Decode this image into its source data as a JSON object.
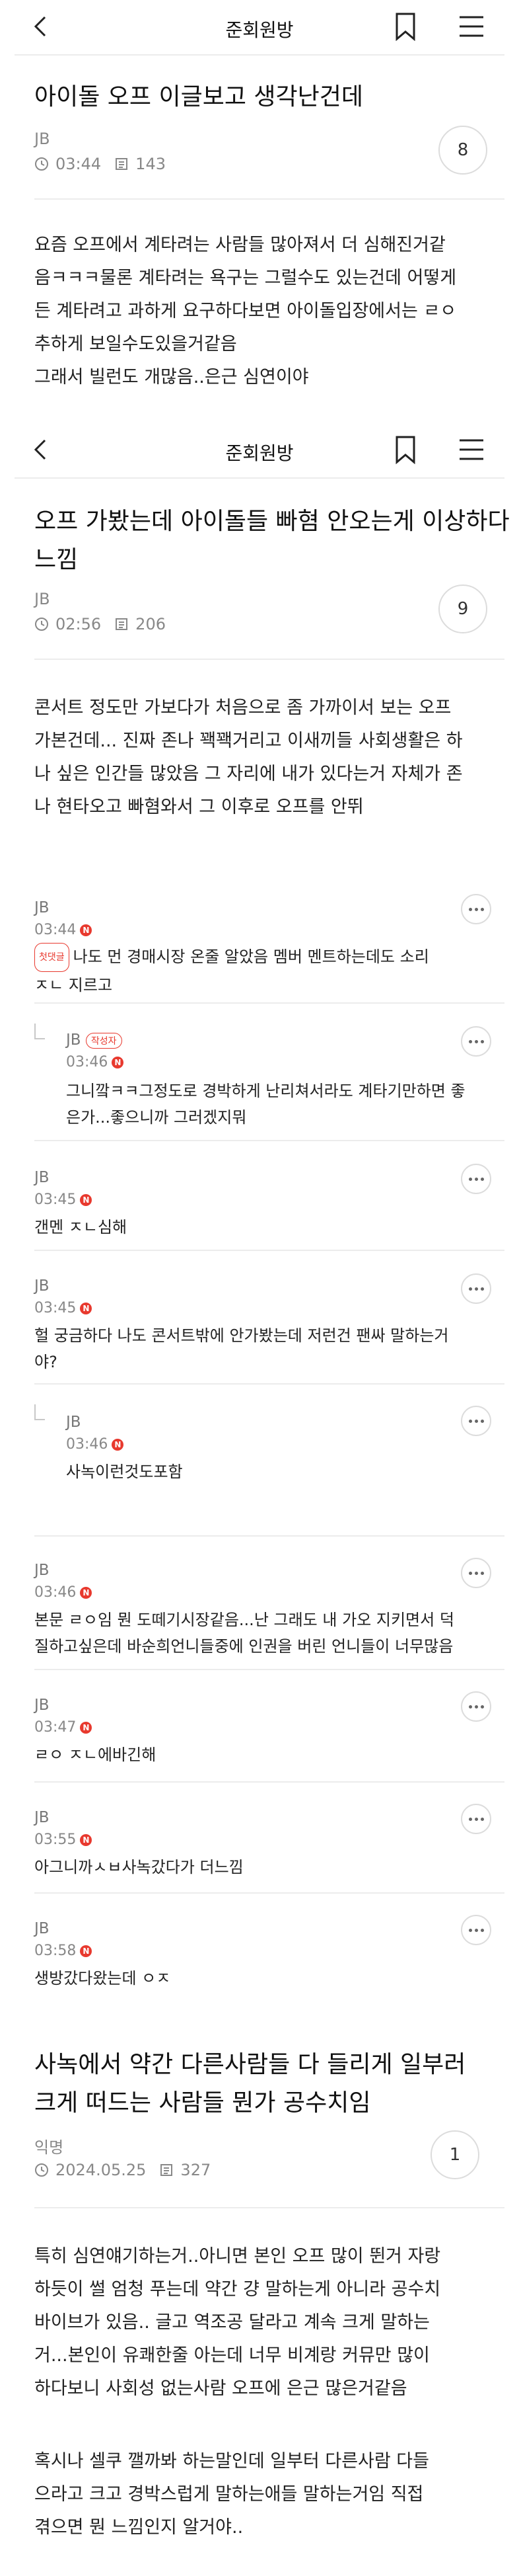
{
  "app": {
    "bar_title": "준회원방",
    "icons": {
      "back": "back-chevron-icon",
      "bookmark": "bookmark-icon",
      "menu": "hamburger-menu-icon",
      "clock": "clock-icon",
      "views": "views-icon",
      "new": "new-badge-icon",
      "more": "more-options-icon"
    },
    "colors": {
      "accent_red": "#e8392e",
      "divider": "#ececec",
      "meta_gray": "#888888"
    }
  },
  "post1": {
    "title": "아이돌 오프 이글보고 생각난건데",
    "author": "JB",
    "time": "03:44",
    "views": "143",
    "comment_count": "8",
    "body": [
      "요즘 오프에서 계타려는 사람들 많아져서 더 심해진거같",
      "음ㅋㅋㅋ물론 계타려는 욕구는 그럴수도 있는건데 어떻게",
      "든 계타려고 과하게 요구하다보면 아이돌입장에서는 ㄹㅇ",
      "추하게 보일수도있을거같음",
      "그래서 빌런도 개많음..은근 심연이야"
    ]
  },
  "post2": {
    "title_lines": [
      "오프 가봤는데 아이돌들 빠혐 안오는게 이상하다",
      "느낌"
    ],
    "author": "JB",
    "time": "02:56",
    "views": "206",
    "comment_count": "9",
    "body": [
      "콘서트 정도만 가보다가 처음으로 좀 가까이서 보는 오프",
      "가본건데... 진짜 존나 꽥꽥거리고 이새끼들 사회생활은 하",
      "나 싶은 인간들 많았음 그 자리에 내가 있다는거 자체가 존",
      "나 현타오고 빠혐와서 그 이후로 오프를 안뛰"
    ],
    "comments": [
      {
        "author": "JB",
        "time": "03:44",
        "first_badge": "첫댓글",
        "lines": [
          "나도 먼 경매시장 온줄 알았음 멤버 멘트하는데도 소리",
          "ㅈㄴ 지르고"
        ]
      },
      {
        "author": "JB",
        "op_badge": "작성자",
        "time": "03:46",
        "lines": [
          "그니깤ㅋㅋ그정도로 경박하게 난리쳐서라도 계타기만하면 좋",
          "은가...좋으니까 그러겠지뭐"
        ]
      },
      {
        "author": "JB",
        "time": "03:45",
        "lines": [
          "갠멘 ㅈㄴ심해"
        ]
      },
      {
        "author": "JB",
        "time": "03:45",
        "lines": [
          "헐 궁금하다 나도 콘서트밖에 안가봤는데 저런건 팬싸 말하는거",
          "야?"
        ]
      },
      {
        "author": "JB",
        "time": "03:46",
        "lines": [
          "사녹이런것도포함"
        ]
      },
      {
        "author": "JB",
        "time": "03:46",
        "lines": [
          "본문 ㄹㅇ임 뭔 도떼기시장같음...난 그래도 내 가오 지키면서 덕",
          "질하고싶은데 바순희언니들중에 인권을 버린 언니들이 너무많음"
        ]
      },
      {
        "author": "JB",
        "time": "03:47",
        "lines": [
          "ㄹㅇ ㅈㄴ에바긴해"
        ]
      },
      {
        "author": "JB",
        "time": "03:55",
        "lines": [
          "아그니까ㅅㅂ사녹갔다가 더느낌"
        ]
      },
      {
        "author": "JB",
        "time": "03:58",
        "lines": [
          "생방갔다왔는데 ㅇㅈ"
        ]
      }
    ]
  },
  "post3": {
    "title_lines": [
      "사녹에서 약간 다른사람들 다 들리게 일부러",
      "크게 떠드는 사람들 뭔가 공수치임"
    ],
    "author": "익명",
    "date": "2024.05.25",
    "views": "327",
    "comment_count": "1",
    "body1": [
      "특히 심연얘기하는거..아니면 본인 오프 많이 뛴거 자랑",
      "하듯이 썰 엄청 푸는데 약간 걍 말하는게 아니라 공수치",
      "바이브가 있음.. 글고 역조공 달라고 계속 크게 말하는",
      "거...본인이 유쾌한줄 아는데 너무 비계랑 커뮤만 많이",
      "하다보니 사회성 없는사람 오프에 은근 많은거같음"
    ],
    "body2": [
      "혹시나 셀쿠 깰까봐 하는말인데 일부터 다른사람 다들",
      "으라고 크고 경박스럽게 말하는애들 말하는거임 직접",
      "겪으면 뭔 느낌인지 알거야.."
    ]
  }
}
